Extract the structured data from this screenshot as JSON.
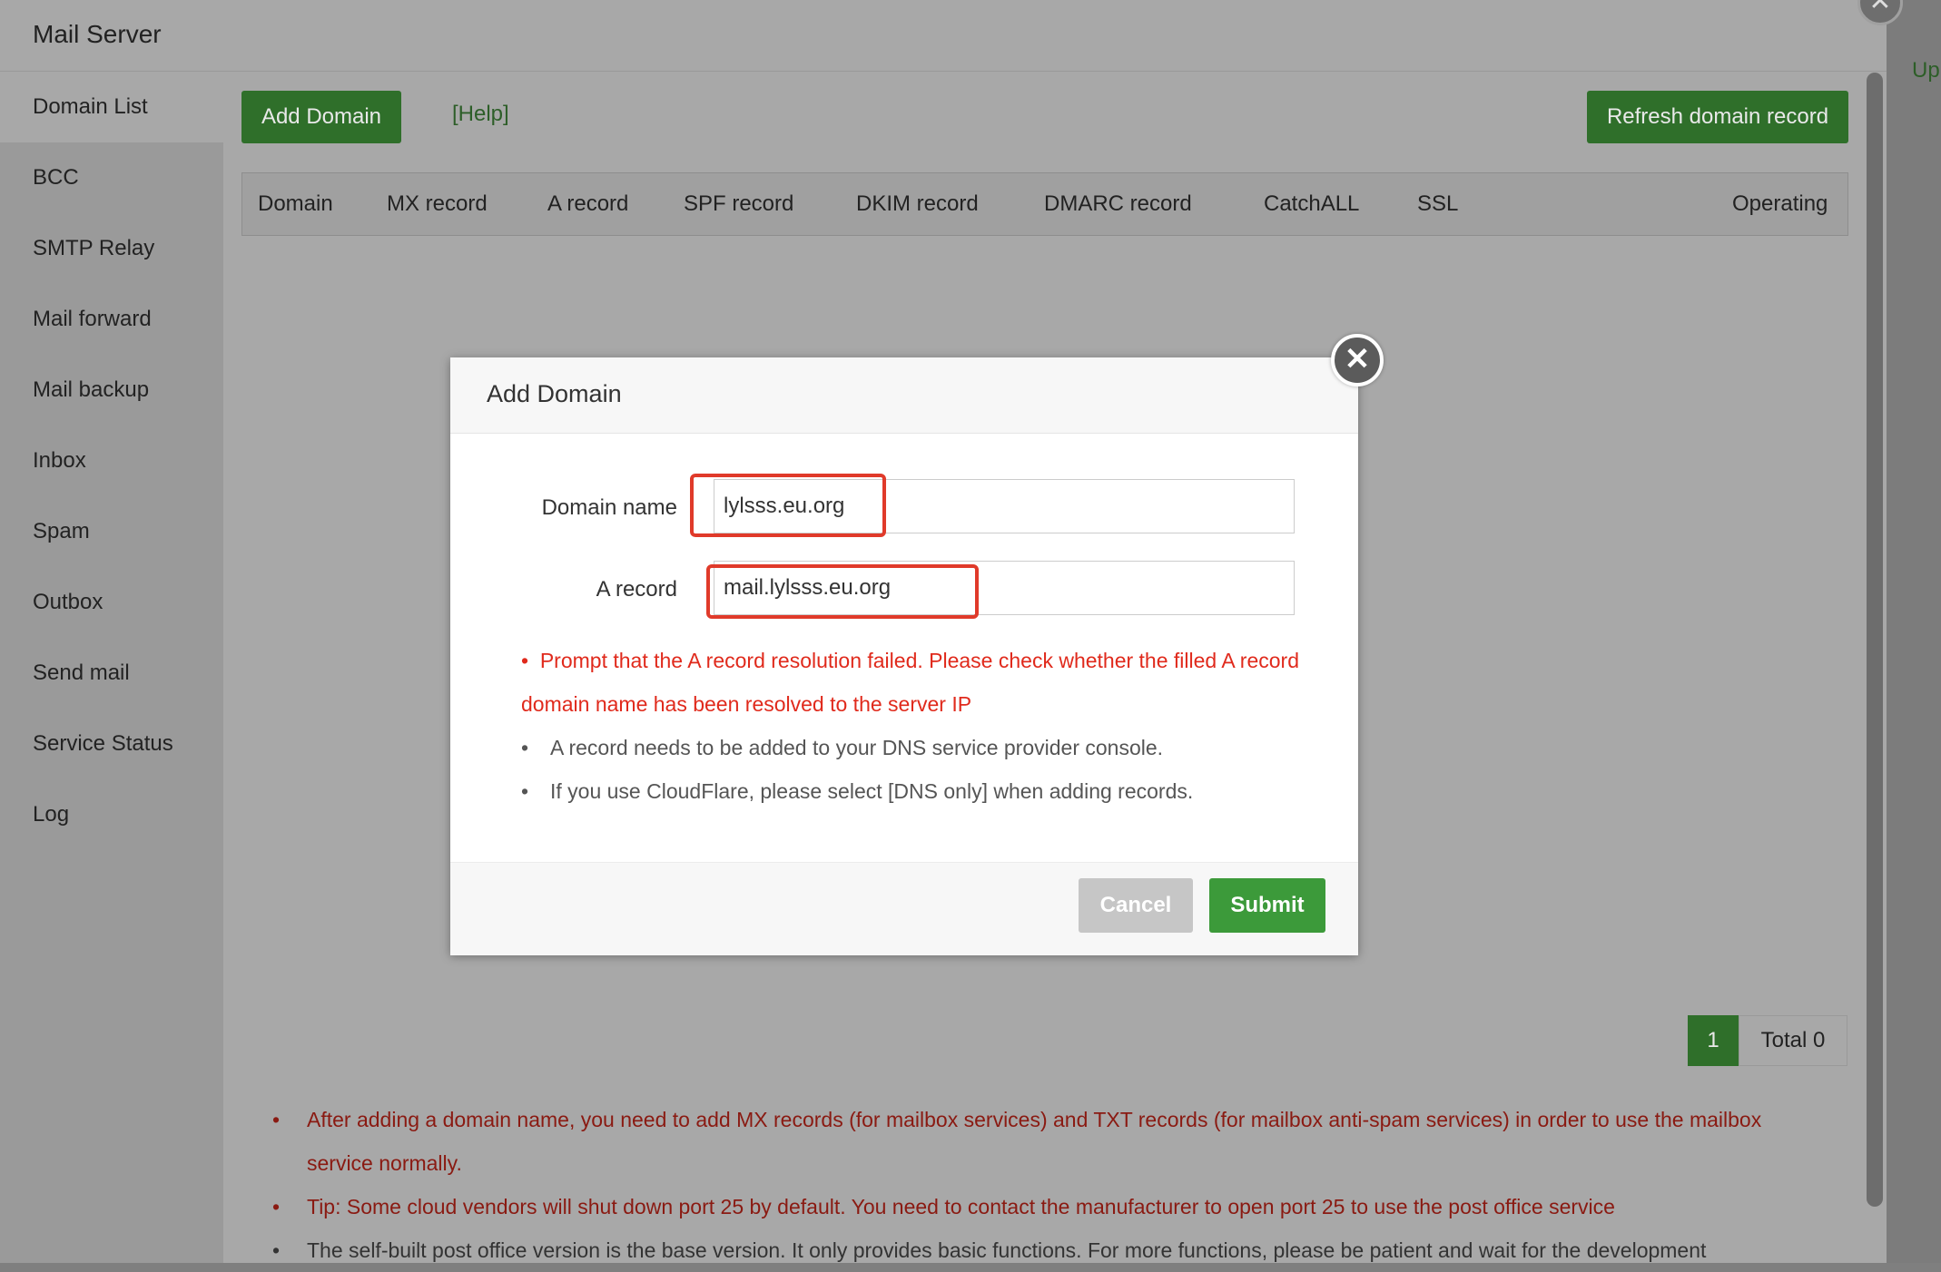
{
  "window": {
    "title": "Mail Server"
  },
  "sidebar": {
    "items": [
      {
        "label": "Domain List"
      },
      {
        "label": "BCC"
      },
      {
        "label": "SMTP Relay"
      },
      {
        "label": "Mail forward"
      },
      {
        "label": "Mail backup"
      },
      {
        "label": "Inbox"
      },
      {
        "label": "Spam"
      },
      {
        "label": "Outbox"
      },
      {
        "label": "Send mail"
      },
      {
        "label": "Service Status"
      },
      {
        "label": "Log"
      }
    ]
  },
  "toolbar": {
    "add_domain_label": "Add Domain",
    "help_label": "[Help]",
    "refresh_label": "Refresh domain record",
    "up_link": "Up"
  },
  "table": {
    "columns": [
      "Domain",
      "MX record",
      "A record",
      "SPF record",
      "DKIM record",
      "DMARC record",
      "CatchALL",
      "SSL",
      "Operating"
    ]
  },
  "pagination": {
    "current": "1",
    "total": "Total 0"
  },
  "notes": [
    "After adding a domain name, you need to add MX records (for mailbox services) and TXT records (for mailbox anti-spam services) in order to use the mailbox service normally.",
    "Tip: Some cloud vendors will shut down port 25 by default. You need to contact the manufacturer to open port 25 to use the post office service",
    "The self-built post office version is the base version. It only provides basic functions. For more functions, please be patient and wait for the development"
  ],
  "modal": {
    "title": "Add Domain",
    "close_glyph": "✕",
    "domain_name_label": "Domain name",
    "domain_name_value": "lylsss.eu.org",
    "a_record_label": "A record",
    "a_record_value": "mail.lylsss.eu.org",
    "tips": [
      "Prompt that the A record resolution failed. Please check whether the filled A record domain name has been resolved to the server IP",
      "A record needs to be added to your DNS service provider console.",
      "If you use CloudFlare, please select [DNS only] when adding records."
    ],
    "cancel_label": "Cancel",
    "submit_label": "Submit"
  },
  "colors": {
    "accent_green": "#3c9a3a",
    "error_red": "#e02a1c",
    "highlight_red": "#e03a2a",
    "overlay": "#7f7f7f"
  }
}
